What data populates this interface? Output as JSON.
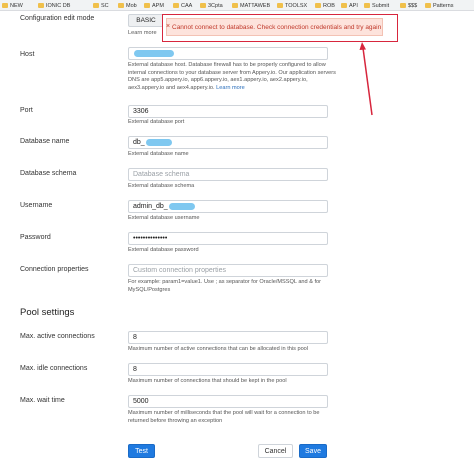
{
  "bookmarks": [
    {
      "label": "NEW",
      "icon": "folder-icon"
    },
    {
      "label": "IONIC DB",
      "icon": "folder-icon"
    },
    {
      "label": "SC",
      "icon": "folder-icon"
    },
    {
      "label": "Mob",
      "icon": "folder-icon"
    },
    {
      "label": "APM",
      "icon": "folder-icon"
    },
    {
      "label": "CAA",
      "icon": "folder-icon"
    },
    {
      "label": "3Cpta",
      "icon": "folder-icon"
    },
    {
      "label": "MATTAWEB",
      "icon": "folder-icon"
    },
    {
      "label": "TOOLSX",
      "icon": "folder-icon"
    },
    {
      "label": "ROB",
      "icon": "folder-icon"
    },
    {
      "label": "API",
      "icon": "folder-icon"
    },
    {
      "label": "Submit",
      "icon": "folder-icon"
    },
    {
      "label": "$$$",
      "icon": "folder-icon"
    },
    {
      "label": "Patterns",
      "icon": "folder-icon"
    }
  ],
  "config_mode": {
    "label": "Configuration edit mode",
    "button": "BASIC",
    "learn_more": "Learn more"
  },
  "toast": {
    "message": "Cannot connect to database. Check connection credentials and try again",
    "close": "×"
  },
  "host": {
    "label": "Host",
    "value": "",
    "help": "External database host. Database firewall has to be properly configured to allow internal connections to your database server from Appery.io. Our application servers DNS are app5.appery.io, app6.appery.io, aex1.appery.io, aex2.appery.io, aex3.appery.io and aex4.appery.io.",
    "help_link": "Learn more"
  },
  "port": {
    "label": "Port",
    "value": "3306",
    "help": "External database port"
  },
  "database_name": {
    "label": "Database name",
    "value": "db_",
    "help": "External database name"
  },
  "database_schema": {
    "label": "Database schema",
    "placeholder": "Database schema",
    "help": "External database schema"
  },
  "username": {
    "label": "Username",
    "value": "admin_db_",
    "help": "External database username"
  },
  "password": {
    "label": "Password",
    "value": "••••••••••••••",
    "help": "External database password"
  },
  "connection_properties": {
    "label": "Connection properties",
    "placeholder": "Custom connection properties",
    "help": "For example: param1=value1. Use ; as separator for Oracle/MSSQL and & for MySQL/Postgres"
  },
  "pool": {
    "title": "Pool settings",
    "max_active": {
      "label": "Max. active connections",
      "value": "8",
      "help": "Maximum number of active connections that can be allocated in this pool"
    },
    "max_idle": {
      "label": "Max. idle connections",
      "value": "8",
      "help": "Maximum number of connections that should be kept in the pool"
    },
    "max_wait": {
      "label": "Max. wait time",
      "value": "5000",
      "help": "Maximum number of milliseconds that the pool will wait for a connection to be returned before throwing an exception"
    }
  },
  "actions": {
    "test": "Test",
    "cancel": "Cancel",
    "save": "Save"
  },
  "colors": {
    "primary": "#1f7ae0",
    "error": "#d7263d",
    "toast_bg": "#fde3dc"
  }
}
